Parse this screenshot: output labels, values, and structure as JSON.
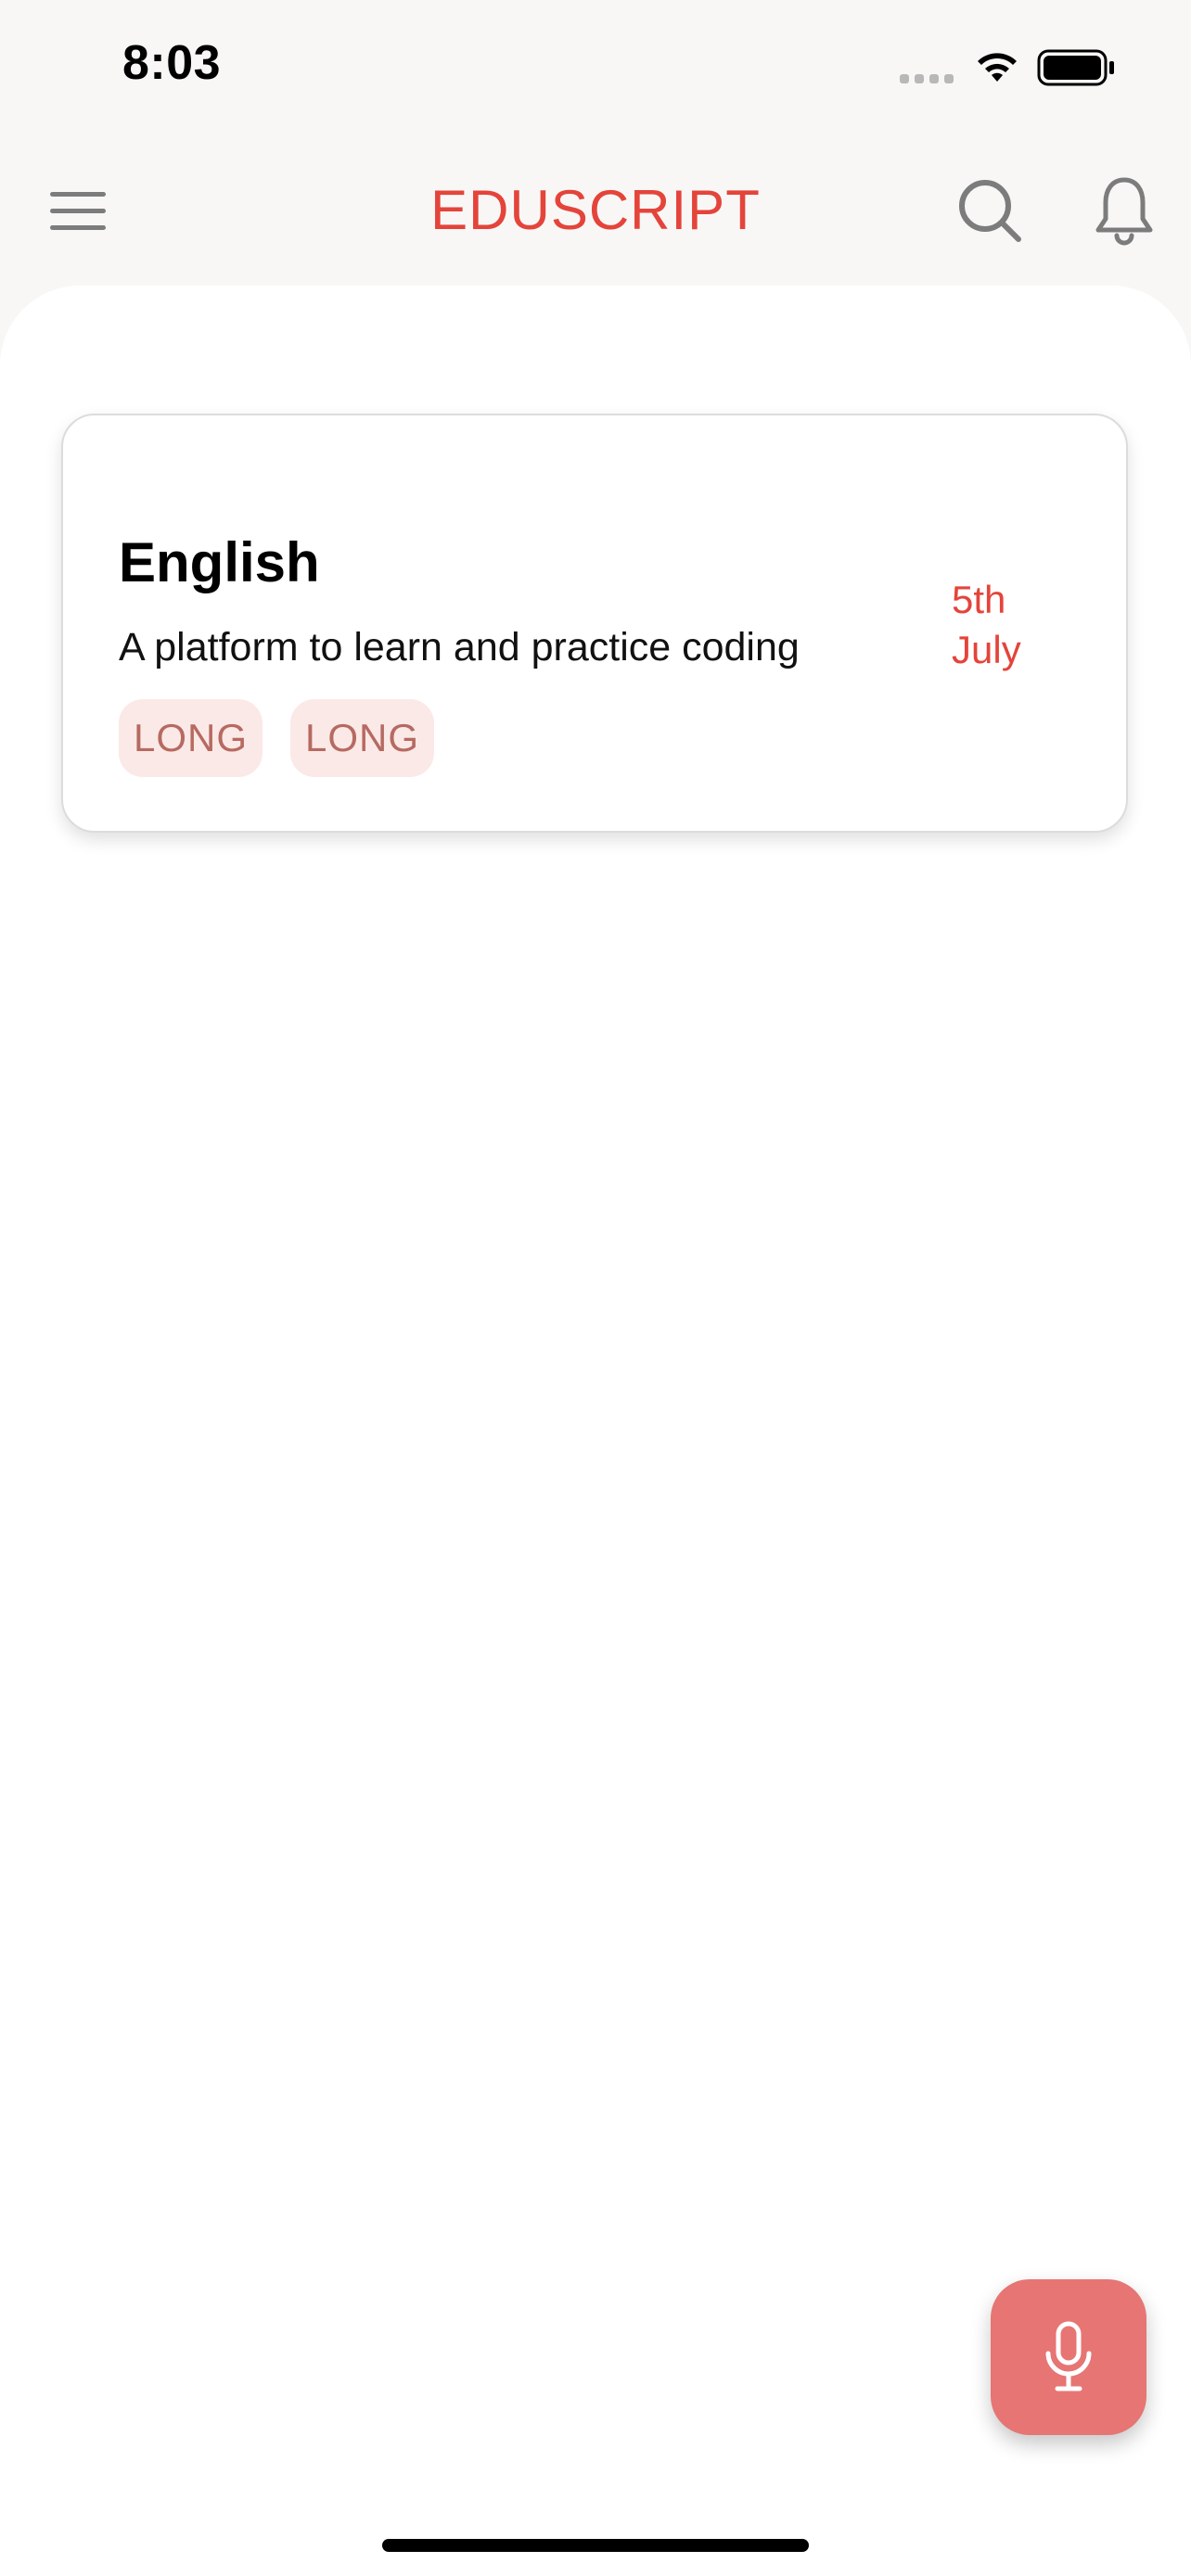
{
  "status_bar": {
    "time": "8:03"
  },
  "app_bar": {
    "title": "EDUSCRIPT",
    "icons": [
      "menu-icon",
      "search-icon",
      "bell-icon"
    ]
  },
  "cards": [
    {
      "title": "English",
      "description": "A platform to learn and practice coding",
      "date_line1": "5th",
      "date_line2": "July",
      "tags": [
        "LONG",
        "LONG"
      ]
    }
  ],
  "fab": {
    "icon": "microphone-icon"
  },
  "colors": {
    "accent": "#e4443a",
    "fab": "#e67574",
    "tag_bg": "#fbe9e7",
    "tag_text": "#b66a61"
  }
}
